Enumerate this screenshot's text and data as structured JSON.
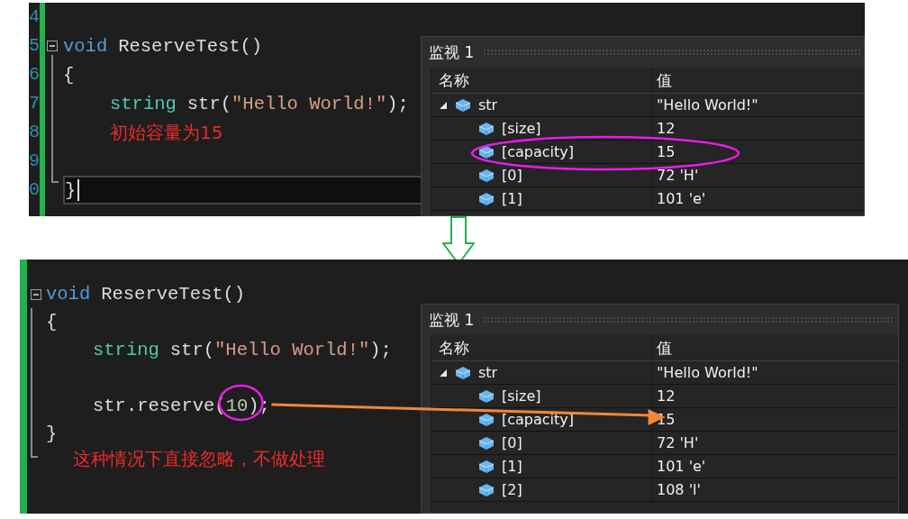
{
  "panels": [
    {
      "line_numbers": [
        "4",
        "5",
        "6",
        "7",
        "8",
        "9",
        "0"
      ],
      "code_lines": [
        {
          "kind": "code"
        },
        {
          "kind": "code",
          "fold": true,
          "tokens": [
            {
              "text": "void",
              "kind": "keyword"
            },
            {
              "text": "ReserveTest()",
              "kind": "plain"
            }
          ]
        },
        {
          "kind": "code",
          "tokens": [
            {
              "text": "{",
              "kind": "plain"
            }
          ]
        },
        {
          "kind": "code",
          "indented": true,
          "tokens": [
            {
              "text": "string",
              "kind": "type"
            },
            {
              "text": "str(",
              "kind": "plain"
            },
            {
              "text": "\"Hello World!\"",
              "kind": "string"
            },
            {
              "text": ");",
              "kind": "plain"
            }
          ]
        },
        {
          "kind": "note",
          "text": "初始容量为15"
        },
        {
          "kind": "code"
        },
        {
          "kind": "code",
          "current": true,
          "tokens": [
            {
              "text": "}",
              "kind": "plain"
            }
          ]
        }
      ],
      "watch": {
        "title": "监视 1",
        "columns": [
          "名称",
          "值"
        ],
        "items": [
          {
            "name": "str",
            "value": "\"Hello World!\"",
            "expanded": true,
            "children": [
              {
                "name": "[size]",
                "value": "12"
              },
              {
                "name": "[capacity]",
                "value": "15"
              },
              {
                "name": "[0]",
                "value": "72 'H'"
              },
              {
                "name": "[1]",
                "value": "101 'e'"
              }
            ]
          }
        ]
      }
    },
    {
      "code_lines": [
        {
          "kind": "code",
          "fold": true,
          "tokens": [
            {
              "text": "void",
              "kind": "keyword"
            },
            {
              "text": "ReserveTest()",
              "kind": "plain"
            }
          ]
        },
        {
          "kind": "code",
          "tokens": [
            {
              "text": "{",
              "kind": "plain"
            }
          ]
        },
        {
          "kind": "code",
          "indented": true,
          "tokens": [
            {
              "text": "string",
              "kind": "type"
            },
            {
              "text": "str(",
              "kind": "plain"
            },
            {
              "text": "\"Hello World!\"",
              "kind": "string"
            },
            {
              "text": ");",
              "kind": "plain"
            }
          ]
        },
        {
          "kind": "code"
        },
        {
          "kind": "code",
          "indented": true,
          "tokens": [
            {
              "text": "str.reserve(",
              "kind": "plain"
            },
            {
              "text": "10",
              "kind": "number"
            },
            {
              "text": ");",
              "kind": "plain"
            }
          ]
        },
        {
          "kind": "code",
          "tokens": [
            {
              "text": "}",
              "kind": "plain"
            }
          ]
        },
        {
          "kind": "note",
          "text": "这种情况下直接忽略，不做处理"
        }
      ],
      "watch": {
        "title": "监视 1",
        "columns": [
          "名称",
          "值"
        ],
        "items": [
          {
            "name": "str",
            "value": "\"Hello World!\"",
            "expanded": true,
            "children": [
              {
                "name": "[size]",
                "value": "12"
              },
              {
                "name": "[capacity]",
                "value": "15"
              },
              {
                "name": "[0]",
                "value": "72 'H'"
              },
              {
                "name": "[1]",
                "value": "101 'e'"
              },
              {
                "name": "[2]",
                "value": "108 'l'"
              }
            ]
          }
        ]
      }
    }
  ]
}
